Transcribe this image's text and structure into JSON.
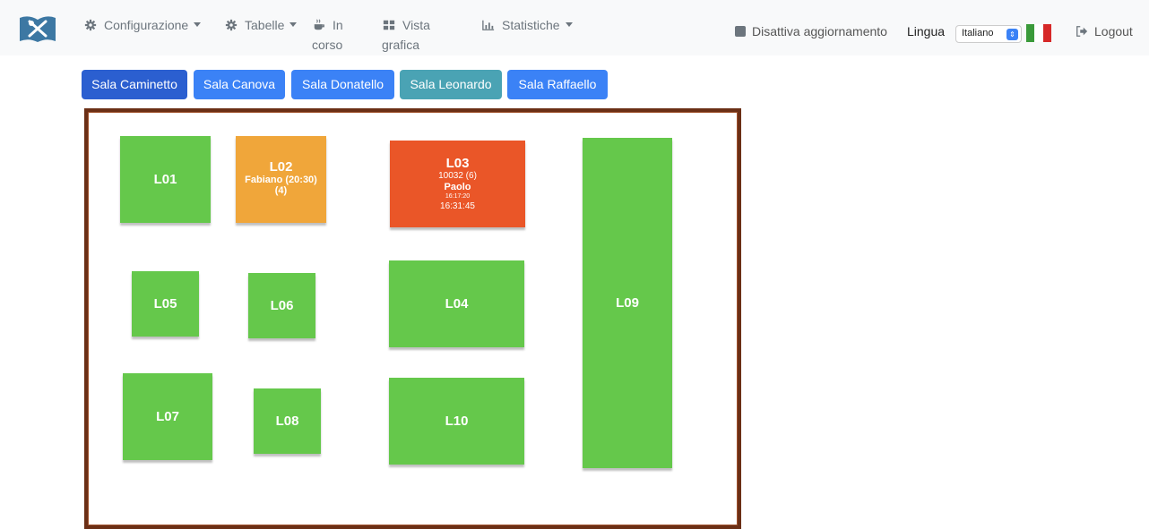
{
  "nav": {
    "configurazione": "Configurazione",
    "tabelle": "Tabelle",
    "in_corso_line1": "In",
    "in_corso_line2": "corso",
    "vista_line1": "Vista",
    "vista_line2": "grafica",
    "statistiche": "Statistiche"
  },
  "right": {
    "disattiva": "Disattiva aggiornamento",
    "lingua_label": "Lingua",
    "lingua_value": "Italiano",
    "logout": "Logout"
  },
  "rooms": [
    {
      "label": "Sala Caminetto",
      "active": true
    },
    {
      "label": "Sala Canova",
      "active": false
    },
    {
      "label": "Sala Donatello",
      "active": false
    },
    {
      "label": "Sala Leonardo",
      "active": false
    },
    {
      "label": "Sala Raffaello",
      "active": false
    }
  ],
  "tables": {
    "L01": {
      "name": "L01",
      "status": "free"
    },
    "L02": {
      "name": "L02",
      "status": "reserved",
      "line1": "Fabiano (20:30)",
      "line2": "(4)"
    },
    "L03": {
      "name": "L03",
      "status": "busy",
      "line1": "10032 (6)",
      "line2": "Paolo",
      "line3": "16:17:20",
      "line4": "16:31:45"
    },
    "L04": {
      "name": "L04",
      "status": "free"
    },
    "L05": {
      "name": "L05",
      "status": "free"
    },
    "L06": {
      "name": "L06",
      "status": "free"
    },
    "L07": {
      "name": "L07",
      "status": "free"
    },
    "L08": {
      "name": "L08",
      "status": "free"
    },
    "L09": {
      "name": "L09",
      "status": "free"
    },
    "L10": {
      "name": "L10",
      "status": "free"
    }
  },
  "colors": {
    "free": "#65c84b",
    "reserved": "#f0a63a",
    "busy": "#ea5628",
    "room_active": "#2b5fd0",
    "room_default": "#3b82f6",
    "room_leonardo": "#4aa3b4"
  }
}
